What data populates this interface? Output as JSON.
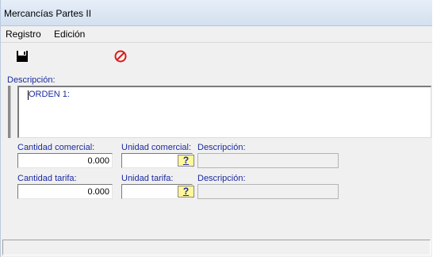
{
  "window": {
    "title": "Mercancías Partes II"
  },
  "menu": {
    "items": [
      "Registro",
      "Edición"
    ]
  },
  "toolbar": {
    "save_icon": "floppy-disk-icon",
    "cancel_icon": "no-entry-icon"
  },
  "form": {
    "descripcion_label": "Descripción:",
    "descripcion_value": "ORDEN 1:",
    "cantidad_comercial_label": "Cantidad comercial:",
    "cantidad_comercial_value": "0.000",
    "unidad_comercial_label": "Unidad comercial:",
    "descripcion_comercial_label": "Descripción:",
    "cantidad_tarifa_label": "Cantidad tarifa:",
    "cantidad_tarifa_value": "0.000",
    "unidad_tarifa_label": "Unidad tarifa:",
    "descripcion_tarifa_label": "Descripción:",
    "lookup_label": "?"
  },
  "colors": {
    "label_blue": "#1a2aa0",
    "lookup_yellow": "#fff79a",
    "cancel_red": "#e01818"
  }
}
